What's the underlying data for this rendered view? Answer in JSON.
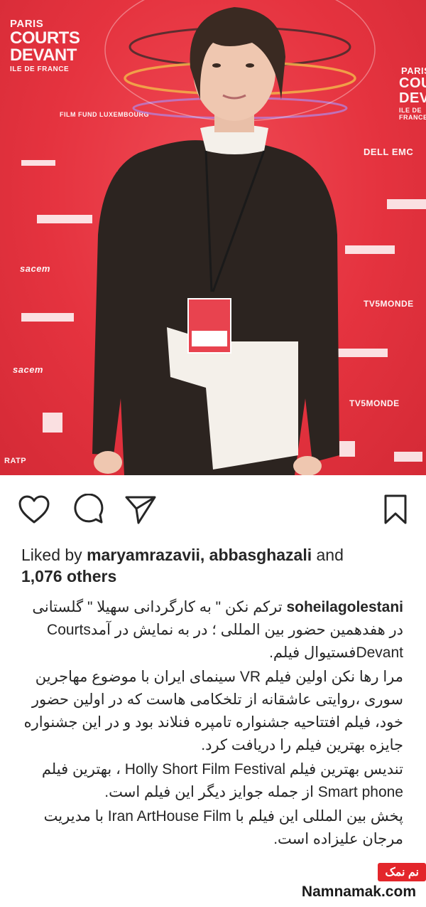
{
  "photo": {
    "sponsors": {
      "paris": "PARIS",
      "courts": "COURTS",
      "devant": "DEVANT",
      "ile": "ILE DE FRANCE",
      "film_fund": "FILM FUND LUXEMBOURG",
      "dell": "DELL EMC",
      "sacem": "sacem",
      "tv5": "TV5MONDE",
      "ratp": "RATP"
    }
  },
  "actions": {
    "like": "heart-icon",
    "comment": "comment-icon",
    "share": "share-icon",
    "save": "bookmark-icon"
  },
  "likes": {
    "prefix": "Liked by ",
    "users": "maryamrazavii, abbasghazali",
    "and": " and",
    "others": "1,076 others"
  },
  "caption": {
    "username": "soheilagolestani",
    "p1": "ترکم نکن \" به کارگردانی سهیلا \" گلستانی  در هفدهمین حضور بین المللی ؛ در به نمایش در آمدCourts Devantفستیوال فیلم.",
    "p2": "مرا رها نکن اولین فیلم VR سینمای ایران با موضوع مهاجرین سوری ،روایتی عاشقانه از تلخکامی هاست که در اولین حضور خود، فیلم افتتاحیه جشنواره تامپره فنلاند بود و در این جشنواره جایزه بهترین فیلم را دریافت کرد.",
    "p3": "تندیس بهترین فیلم Holly Short Film Festival ، بهترین فیلم Smart phone  از جمله جوایز دیگر این فیلم است.",
    "p4": "پخش بین المللی این فیلم با  Iran ArtHouse Film با مدیریت مرجان علیزاده است."
  },
  "watermark": {
    "badge": "نم نمک",
    "site": "Namnamak.com"
  }
}
